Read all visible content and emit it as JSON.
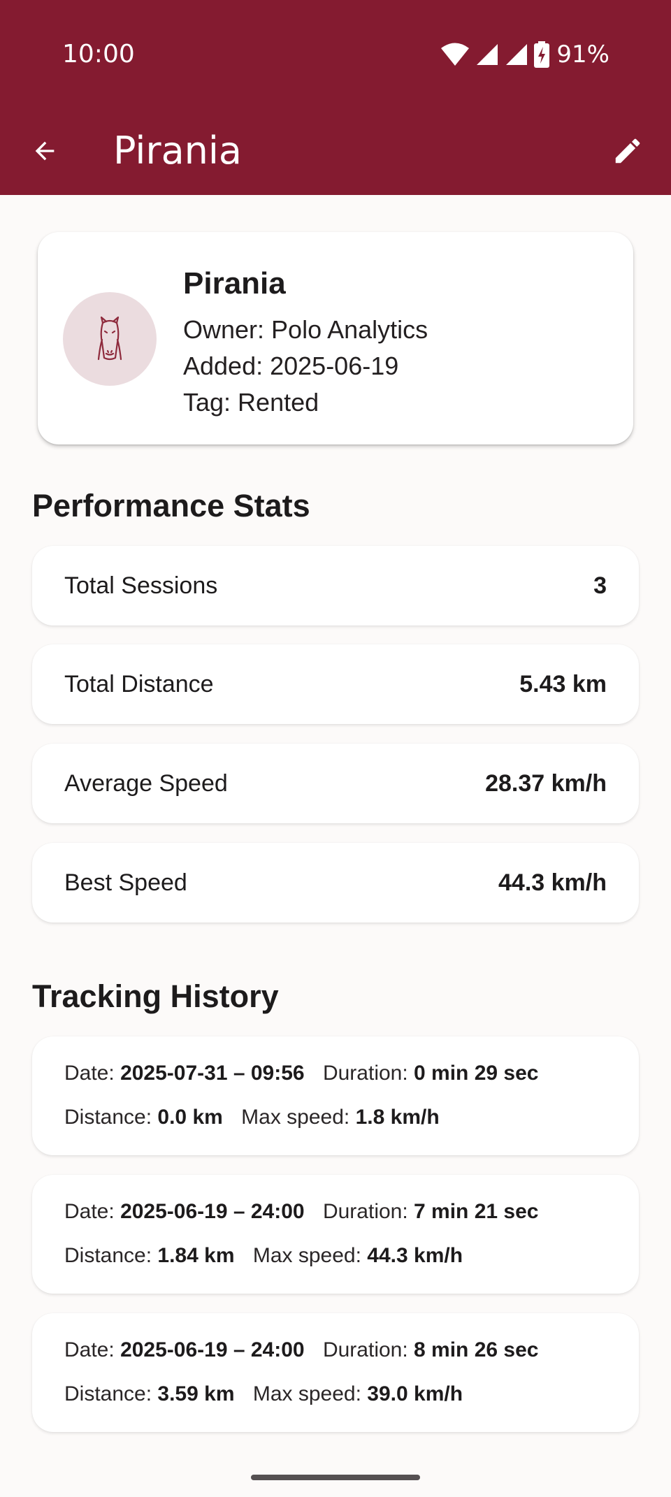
{
  "status_bar": {
    "time": "10:00",
    "battery": "91%",
    "icons": [
      "wifi-icon",
      "cell-signal-icon",
      "cell-signal-icon",
      "battery-charging-icon"
    ]
  },
  "app_bar": {
    "title": "Pirania",
    "back_icon": "arrow-back-icon",
    "edit_icon": "pencil-icon",
    "color": "#841B30"
  },
  "profile": {
    "name": "Pirania",
    "owner_label": "Owner: Polo Analytics",
    "added_label": "Added: 2025-06-19",
    "tag_label": "Tag: Rented",
    "avatar_icon": "horse-head-icon"
  },
  "performance": {
    "title": "Performance Stats",
    "stats": [
      {
        "label": "Total Sessions",
        "value": "3"
      },
      {
        "label": "Total Distance",
        "value": "5.43 km"
      },
      {
        "label": "Average Speed",
        "value": "28.37 km/h"
      },
      {
        "label": "Best Speed",
        "value": "44.3 km/h"
      }
    ]
  },
  "history": {
    "title": "Tracking History",
    "labels": {
      "date": "Date:",
      "duration": "Duration:",
      "distance": "Distance:",
      "max_speed": "Max speed:"
    },
    "sessions": [
      {
        "date": "2025-07-31 – 09:56",
        "duration": "0 min 29 sec",
        "distance": "0.0 km",
        "max_speed": "1.8 km/h"
      },
      {
        "date": "2025-06-19 – 24:00",
        "duration": "7 min 21 sec",
        "distance": "1.84 km",
        "max_speed": "44.3 km/h"
      },
      {
        "date": "2025-06-19 – 24:00",
        "duration": "8 min 26 sec",
        "distance": "3.59 km",
        "max_speed": "39.0 km/h"
      }
    ]
  }
}
